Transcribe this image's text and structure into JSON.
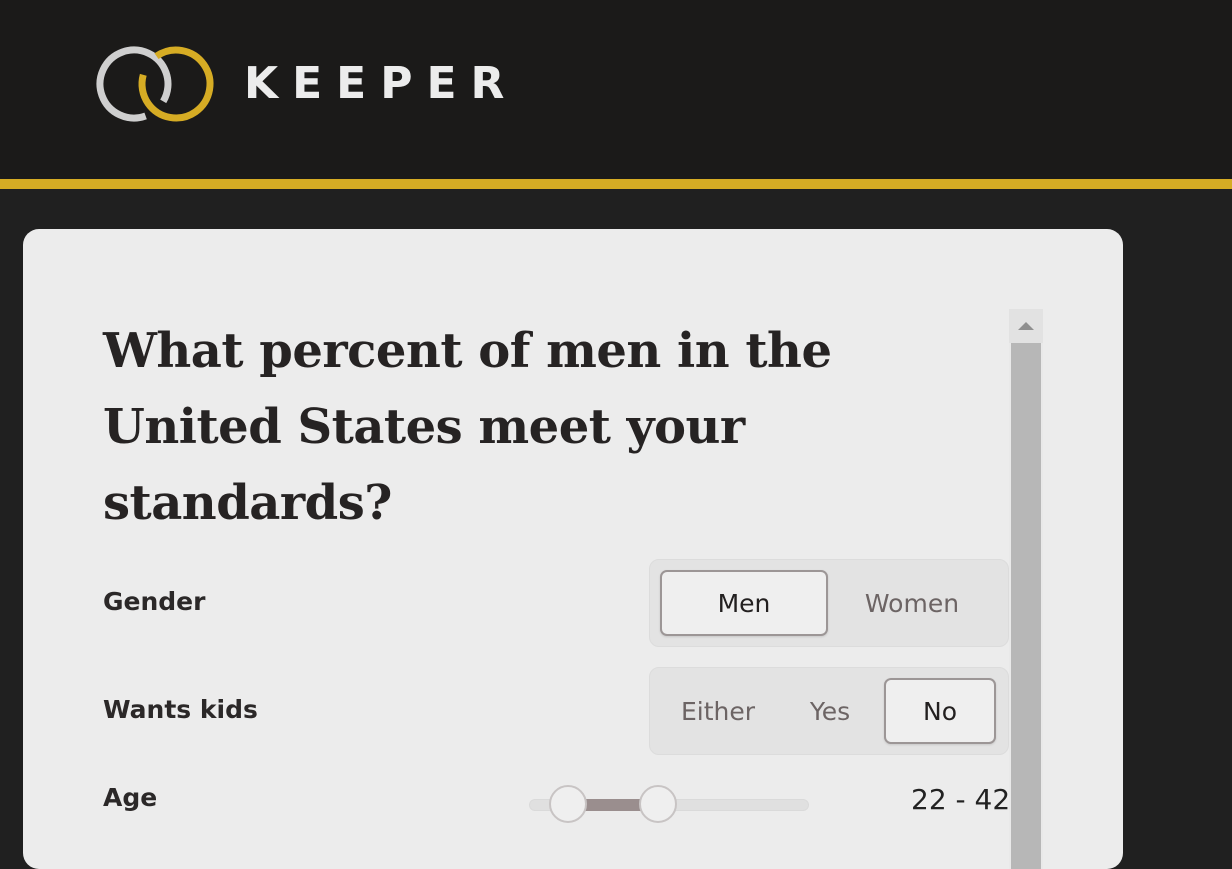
{
  "header": {
    "brand": "KEEPER",
    "logo_icon": "interlocked-rings-icon",
    "accent_color": "#d6ac24"
  },
  "card": {
    "question": "What percent of men in the United States meet your standards?",
    "filters": {
      "gender": {
        "label": "Gender",
        "options": [
          "Men",
          "Women"
        ],
        "selected": "Men"
      },
      "wants_kids": {
        "label": "Wants kids",
        "options": [
          "Either",
          "Yes",
          "No"
        ],
        "selected": "No"
      },
      "age": {
        "label": "Age",
        "min_value": 22,
        "max_value": 42,
        "display": "22 - 42",
        "low_fraction": 0.14,
        "high_fraction": 0.46
      }
    }
  },
  "scrollbar": {
    "up_icon": "triangle-up-icon"
  }
}
